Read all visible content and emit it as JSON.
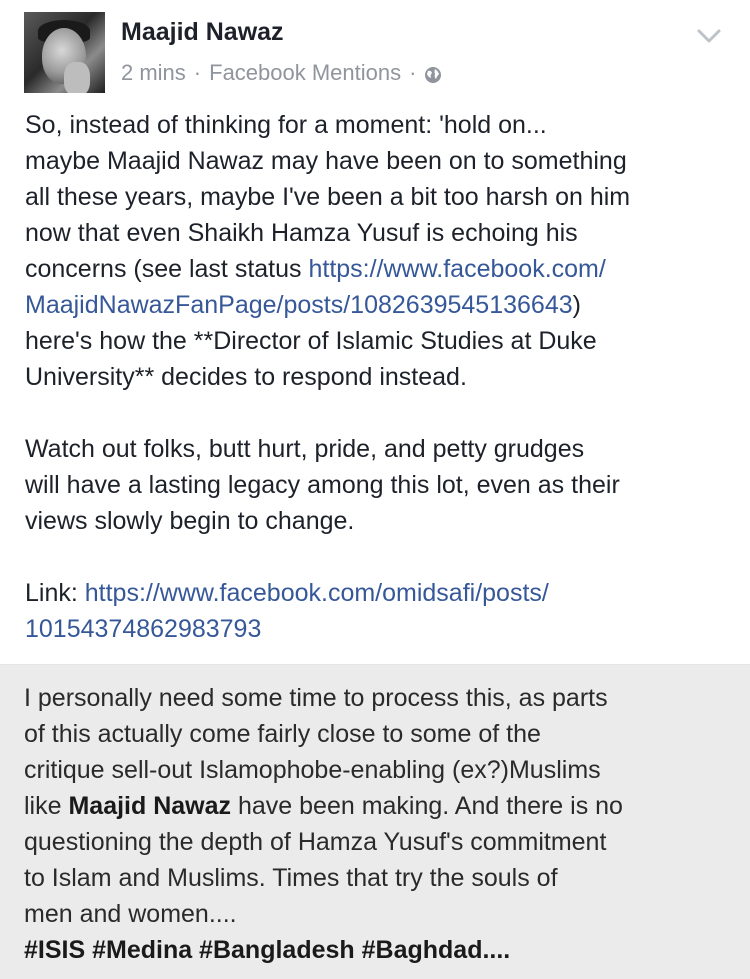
{
  "post": {
    "author": "Maajid Nawaz",
    "time": "2 mins",
    "source": "Facebook Mentions",
    "dot1": "·",
    "dot2": "·",
    "paragraph1": {
      "line1": "So, instead of thinking for a moment: 'hold on...",
      "line2": "maybe Maajid Nawaz may have been on to something",
      "line3": "all these years, maybe I've been a bit too harsh on him",
      "line4": "now that even Shaikh Hamza Yusuf is echoing his",
      "line5_text": "concerns (see last status ",
      "line5_link": "https://www.facebook.com/",
      "line6_link": "MaajidNawazFanPage/posts/1082639545136643",
      "line6_text": ")",
      "line7": "here's how the **Director of Islamic Studies at Duke",
      "line8": "University** decides to respond instead."
    },
    "paragraph2": {
      "line1": "Watch out folks, butt hurt, pride, and petty grudges",
      "line2": "will have a lasting legacy among this lot, even as their",
      "line3": "views slowly begin to change."
    },
    "paragraph3": {
      "label": "Link: ",
      "link_line1": "https://www.facebook.com/omidsafi/posts/",
      "link_line2": "10154374862983793"
    }
  },
  "quote": {
    "line1": "I personally need some time to process this, as parts",
    "line2": "of this actually come fairly close to some of the",
    "line3": "critique sell-out Islamophobe-enabling (ex?)Muslims",
    "line4_prefix": "like ",
    "line4_bold": "Maajid Nawaz",
    "line4_suffix": " have been making. And there is no",
    "line5": "questioning the depth of Hamza Yusuf's commitment",
    "line6": "to Islam and Muslims.  Times that try the souls of",
    "line7": "men and women....",
    "line8": "#ISIS #Medina #Bangladesh #Baghdad...."
  },
  "colors": {
    "link": "#365899",
    "meta": "#90949c",
    "text": "#1d2129",
    "quote_bg": "#ebebeb"
  },
  "icons": {
    "audience": "globe-icon",
    "menu": "chevron-down-icon"
  }
}
